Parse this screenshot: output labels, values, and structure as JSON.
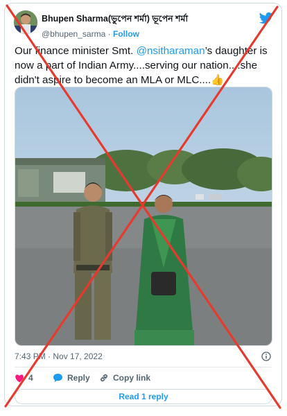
{
  "tweet": {
    "display_name": "Bhupen Sharma(ভুপেন শৰ্মা) ভূপেন শৰ্মা",
    "handle": "@bhupen_sarma",
    "separator": "·",
    "follow_label": "Follow",
    "text_before": "Our finance minister Smt. ",
    "mention": "@nsitharaman",
    "text_after": "’s daughter is now a part of Indian Army....serving our nation....she didn't aspire to become an MLA or MLC....",
    "emoji": "👍",
    "timestamp": "7:43 PM · Nov 17, 2022"
  },
  "actions": {
    "like_count": "4",
    "reply_label": "Reply",
    "copy_label": "Copy link",
    "read_label": "Read 1 reply"
  },
  "icons": {
    "brand": "twitter-bird-icon",
    "info": "info-icon",
    "like": "heart-icon",
    "reply": "speech-bubble-icon",
    "copy": "link-icon"
  },
  "colors": {
    "accent": "#1d9bf0",
    "like": "#f91880",
    "cross": "#e63a2e"
  }
}
